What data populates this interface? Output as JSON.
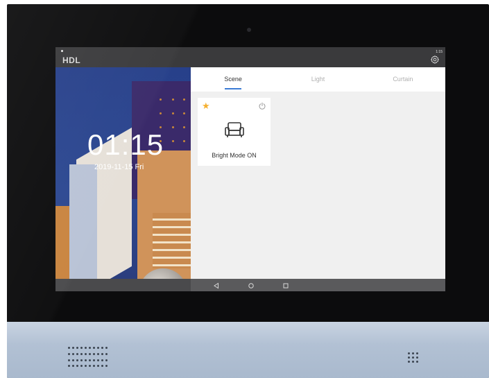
{
  "status_bar": {
    "logo": "HDL",
    "time": "1:15",
    "settings_icon": "gear-icon"
  },
  "home": {
    "clock": "01:15",
    "date": "2019-11-15 Fri"
  },
  "tabs": [
    {
      "label": "Scene",
      "active": true
    },
    {
      "label": "Light",
      "active": false
    },
    {
      "label": "Curtain",
      "active": false
    }
  ],
  "scene_card": {
    "label": "Bright Mode ON",
    "favorite_icon": "star-icon",
    "power_icon": "power-icon",
    "scene_icon": "sofa-icon",
    "favorite_color": "#f5b030"
  },
  "nav_bar": {
    "back_icon": "back-triangle-icon",
    "home_icon": "home-circle-icon",
    "recents_icon": "recents-square-icon"
  },
  "colors": {
    "accent": "#3a7bd5",
    "panel_background": "#f0f0f0"
  }
}
